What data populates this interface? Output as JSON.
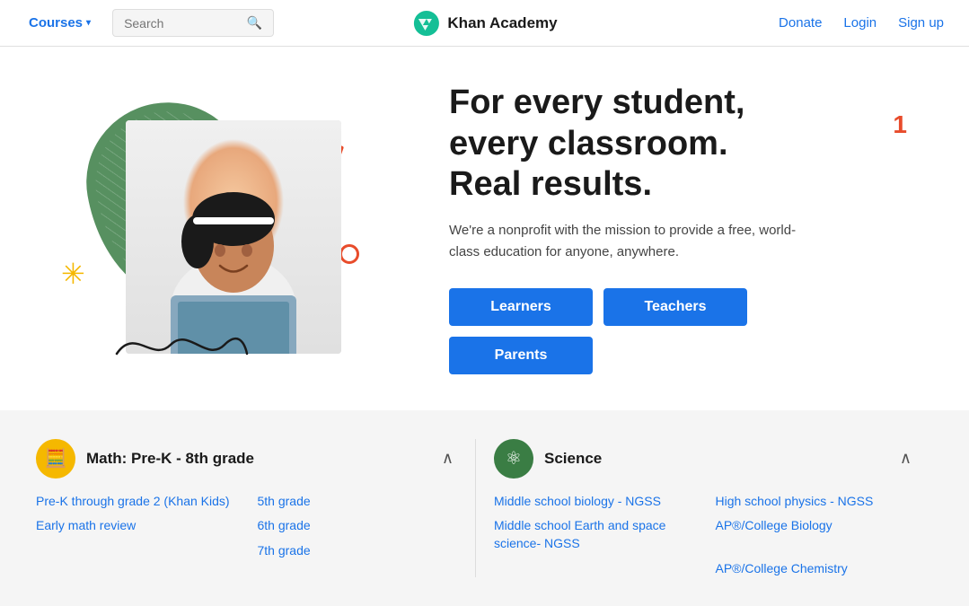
{
  "nav": {
    "courses_label": "Courses",
    "search_placeholder": "Search",
    "logo_text": "Khan Academy",
    "donate_label": "Donate",
    "login_label": "Login",
    "signup_label": "Sign up"
  },
  "hero": {
    "headline_line1": "For every student,",
    "headline_line2": "every classroom.",
    "headline_line3": "Real results.",
    "counter": "1",
    "subtext": "We're a nonprofit with the mission to provide a free, world-class education for anyone, anywhere.",
    "btn_learners": "Learners",
    "btn_teachers": "Teachers",
    "btn_parents": "Parents"
  },
  "courses": {
    "math": {
      "title": "Math: Pre-K - 8th grade",
      "icon": "🧮",
      "links": [
        "Pre-K through grade 2 (Khan Kids)",
        "5th grade",
        "Early math review",
        "6th grade",
        "",
        "7th grade"
      ]
    },
    "science": {
      "title": "Science",
      "icon": "⚛",
      "links": [
        "Middle school biology - NGSS",
        "High school physics - NGSS",
        "Middle school Earth and space science- NGSS",
        "AP®/College Biology",
        "",
        "AP®/College Chemistry"
      ]
    }
  }
}
